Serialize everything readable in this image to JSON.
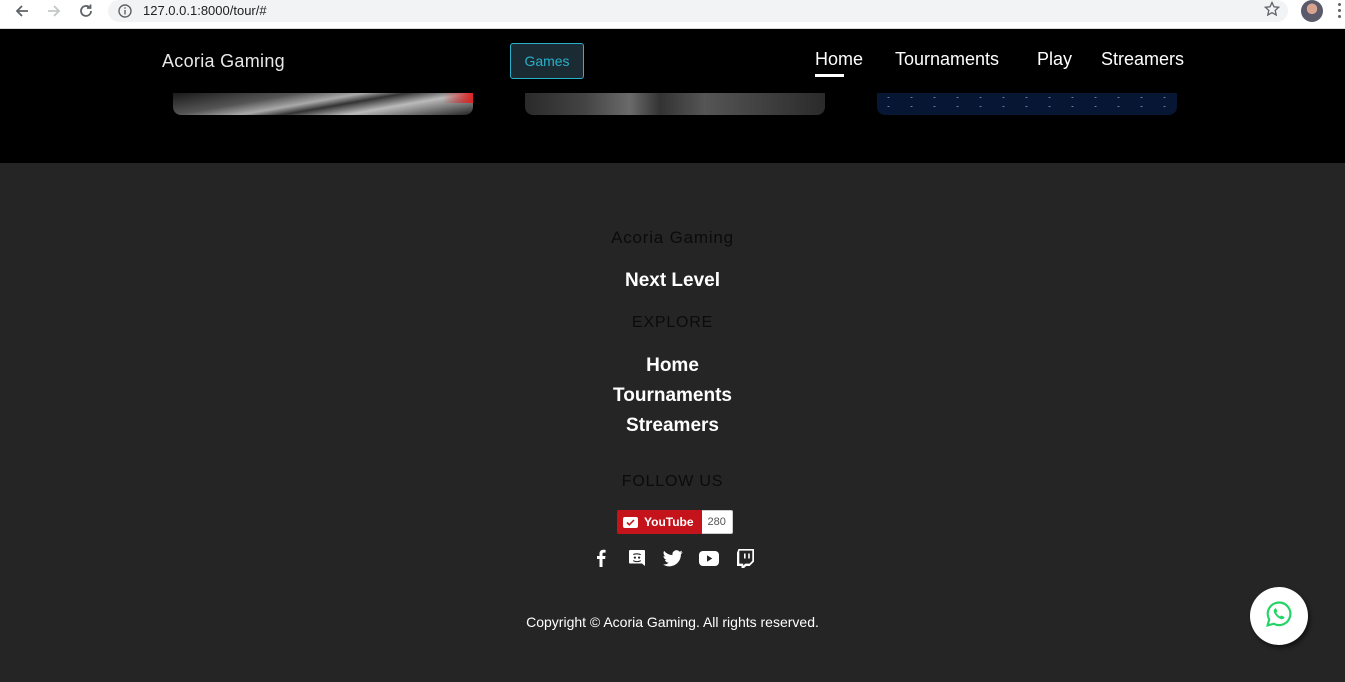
{
  "browser": {
    "url": "127.0.0.1:8000/tour/#"
  },
  "header": {
    "brand": "Acoria Gaming",
    "games_button": "Games",
    "nav": [
      {
        "label": "Home",
        "active": true
      },
      {
        "label": "Tournaments",
        "active": false
      },
      {
        "label": "Play",
        "active": false
      },
      {
        "label": "Streamers",
        "active": false
      }
    ]
  },
  "footer": {
    "brand": "Acoria Gaming",
    "tagline": "Next Level",
    "explore_heading": "EXPLORE",
    "links": [
      "Home",
      "Tournaments",
      "Streamers"
    ],
    "follow_heading": "FOLLOW US",
    "youtube": {
      "label": "YouTube",
      "count": "280"
    },
    "socials": [
      "facebook-icon",
      "discord-icon",
      "twitter-icon",
      "youtube-icon",
      "twitch-icon"
    ],
    "copyright": "Copyright © Acoria Gaming. All rights reserved."
  },
  "colors": {
    "accent": "#2ab0c9",
    "footer_bg": "#252525",
    "header_bg": "#000000",
    "youtube_red": "#c4131b",
    "whatsapp_green": "#25d366"
  }
}
